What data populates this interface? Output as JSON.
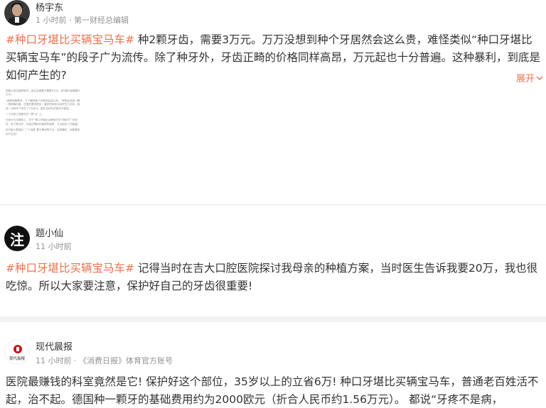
{
  "posts": [
    {
      "author": "杨宇东",
      "meta": "1 小时前 · 第一财经总编辑",
      "hashtag": "#种口牙堪比买辆宝马车#",
      "text": " 种2颗牙齿，需要3万元。万万没想到种个牙居然会这么贵，难怪类似“种口牙堪比买辆宝马车”的段子广为流传。除了种牙外，牙齿正畸的价格同样高昂，万元起也十分普遍。这种暴利，到底是如何产生的?",
      "expand_label": "展开",
      "thumbnail_paragraphs": [
        "同事父亲去医院种牙，医生说两颗牙需要3万元，种2颗牙齿需要3万元。",
        "“我种到两颗牙，才了解到种个牙居然会这么贵。”有网友说到一颗一般种植价格，在国外要贵很多，痛苦的体验与经济压力并存，我说一次种牙下来花了7万多元，国外治疗的花费也不便宜。",
        "一个月的工资都花在一颗“牙”上。",
        "在各大社交媒体上，关于“种口牙堪比买辆宝马车”的段子广为流传，除了种牙外，牙齿正畸的价格同样高昂，万元起也十分普遍。",
        "在牙医人数增长“二个也越”基于暴利的行业，这种暴利，到底是如何产生的?"
      ]
    },
    {
      "author": "题小仙",
      "avatar_char": "注",
      "meta": "11 小时前",
      "hashtag": "#种口牙堪比买辆宝马车#",
      "text": " 记得当时在吉大口腔医院探讨我母亲的种植方案，当时医生告诉我要20万，我也很吃惊。所以大家要注意，保护好自己的牙齿很重要!"
    },
    {
      "author": "现代晨报",
      "logo_text": "现代晨报",
      "meta": "11 小时前 · 《消费日报》体育官方账号",
      "text": "医院最赚钱的科室竟然是它! 保护好这个部位，35岁以上的立省6万! 种口牙堪比买辆宝马车，普通老百姓活不起，治不起。德国种一颗牙的基础费用约为2000欧元（折合人民币约1.56万元）。 都说“牙疼不是病，"
    }
  ],
  "colors": {
    "hashtag": "#eb7350",
    "meta": "#939393",
    "divider": "#f2f2f2"
  }
}
